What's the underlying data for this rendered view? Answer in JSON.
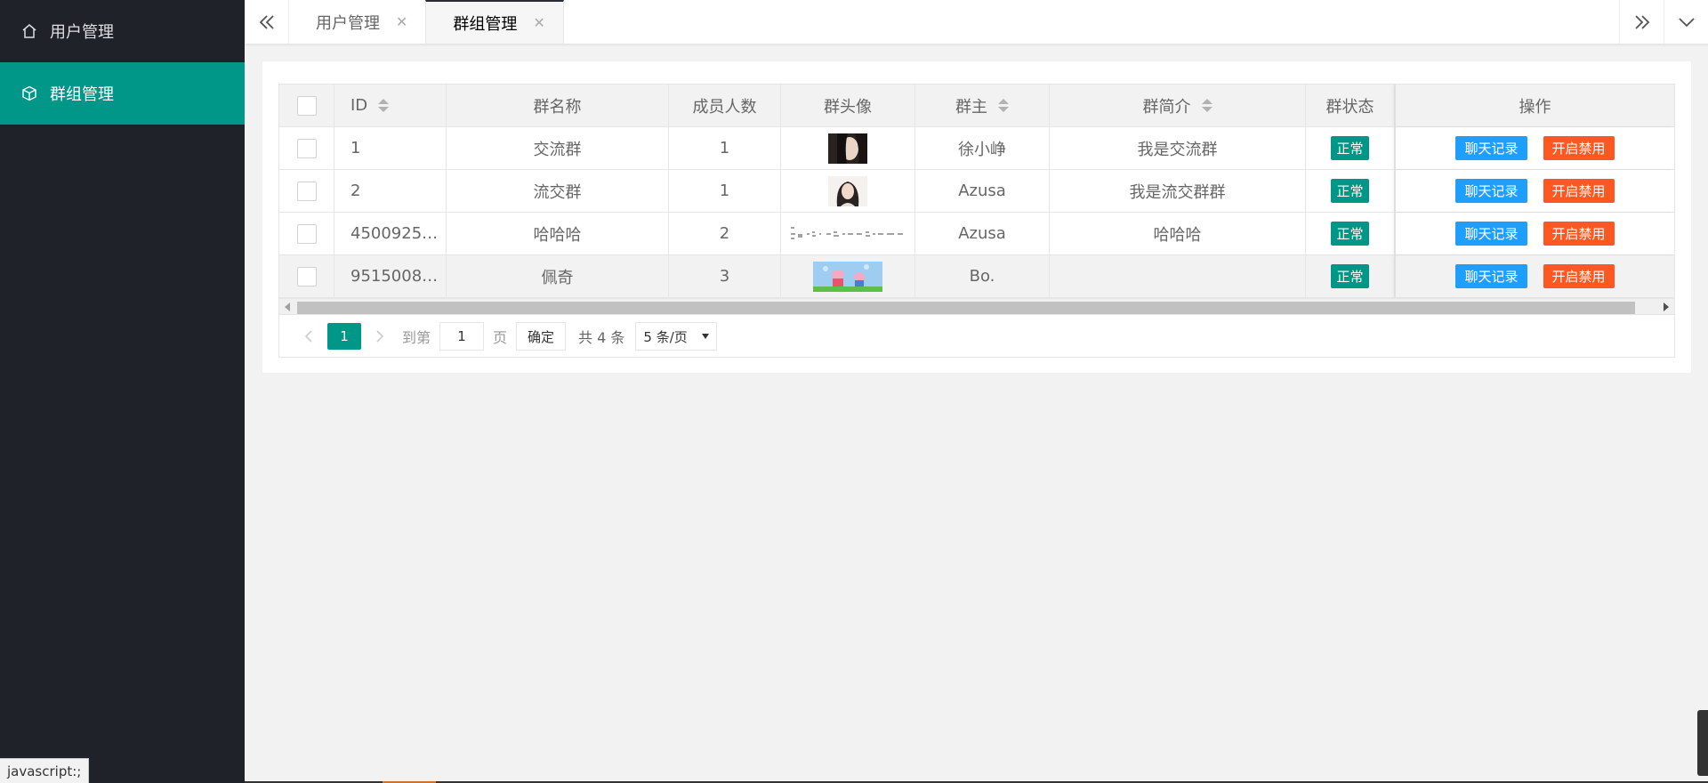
{
  "sidebar": {
    "items": [
      {
        "label": "用户管理",
        "icon": "home-icon",
        "active": false
      },
      {
        "label": "群组管理",
        "icon": "cube-icon",
        "active": true
      }
    ]
  },
  "tabs": [
    {
      "label": "用户管理",
      "active": false
    },
    {
      "label": "群组管理",
      "active": true
    }
  ],
  "table": {
    "columns": [
      "ID",
      "群名称",
      "成员人数",
      "群头像",
      "群主",
      "群简介",
      "群状态",
      "操作"
    ],
    "rows": [
      {
        "id": "1",
        "name": "交流群",
        "members": "1",
        "avatar": "dark-portrait",
        "owner": "徐小峥",
        "intro": "我是交流群",
        "status": "正常"
      },
      {
        "id": "2",
        "name": "流交群",
        "members": "1",
        "avatar": "woman-portrait",
        "owner": "Azusa",
        "intro": "我是流交群群",
        "status": "正常"
      },
      {
        "id": "4500925…",
        "name": "哈哈哈",
        "members": "2",
        "avatar": "math-formula",
        "owner": "Azusa",
        "intro": "哈哈哈",
        "status": "正常"
      },
      {
        "id": "9515008…",
        "name": "佩奇",
        "members": "3",
        "avatar": "peppa-pig",
        "owner": "Bo.",
        "intro": "",
        "status": "正常"
      }
    ],
    "actions": {
      "chat": "聊天记录",
      "ban": "开启禁用"
    }
  },
  "pager": {
    "current": "1",
    "goto_label": "到第",
    "page_input": "1",
    "page_label": "页",
    "confirm": "确定",
    "total": "共 4 条",
    "size": "5 条/页"
  },
  "status_tip": "javascript:;",
  "colors": {
    "sidebar_bg": "#20222a",
    "accent": "#009688",
    "blue": "#1e9fff",
    "orange": "#ff5722"
  }
}
